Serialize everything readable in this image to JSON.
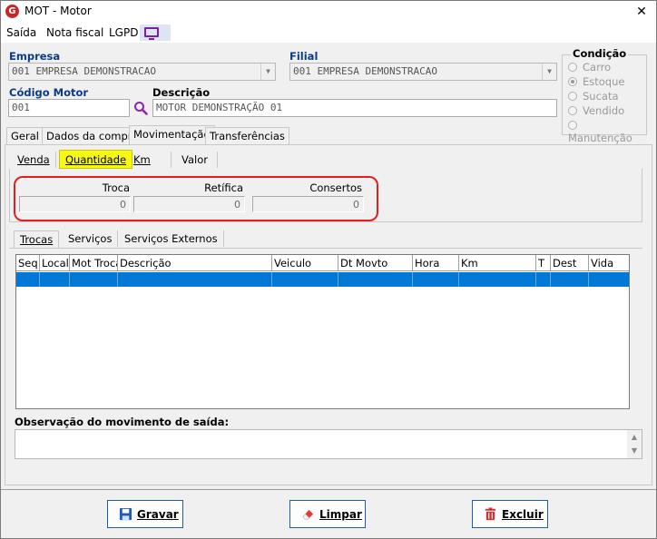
{
  "window": {
    "title": "MOT - Motor",
    "app_icon_letter": "G",
    "close_glyph": "✕"
  },
  "menu": {
    "items": [
      "Saída",
      "Nota fiscal",
      "LGPD"
    ]
  },
  "empresa": {
    "label": "Empresa",
    "value": "001 EMPRESA DEMONSTRACAO"
  },
  "filial": {
    "label": "Filial",
    "value": "001 EMPRESA DEMONSTRACAO"
  },
  "codigo_motor": {
    "label": "Código Motor",
    "value": "001"
  },
  "descricao": {
    "label": "Descrição",
    "value": "MOTOR DEMONSTRAÇÃO 01"
  },
  "condicao": {
    "label": "Condição",
    "options": [
      "Carro",
      "Estoque",
      "Sucata",
      "Vendido",
      "Manutenção"
    ],
    "selected": "Estoque"
  },
  "tabs": [
    "Geral",
    "Dados da compra",
    "Movimentação",
    "Transferências"
  ],
  "active_tab": "Movimentação",
  "subtabs": [
    "Venda",
    "Quantidade",
    "Km",
    "Valor"
  ],
  "active_subtab": "Quantidade",
  "quantidade": {
    "troca_label": "Troca",
    "troca_value": "0",
    "retifica_label": "Retífica",
    "retifica_value": "0",
    "consertos_label": "Consertos",
    "consertos_value": "0"
  },
  "lower_tabs": [
    "Trocas",
    "Serviços",
    "Serviços Externos"
  ],
  "active_lower_tab": "Trocas",
  "table": {
    "columns": [
      "Seq",
      "Local",
      "Mot Troca",
      "Descrição",
      "Veiculo",
      "Dt Movto",
      "Hora",
      "Km",
      "T",
      "Dest",
      "Vida"
    ]
  },
  "observacao": {
    "label": "Observação do movimento de saída:",
    "value": ""
  },
  "buttons": {
    "gravar": "Gravar",
    "limpar": "Limpar",
    "excluir": "Excluir"
  },
  "colors": {
    "accent_blue": "#0b3a8c",
    "selection": "#0078d7",
    "highlight": "#f7f714",
    "annotation_red": "#e02020"
  }
}
